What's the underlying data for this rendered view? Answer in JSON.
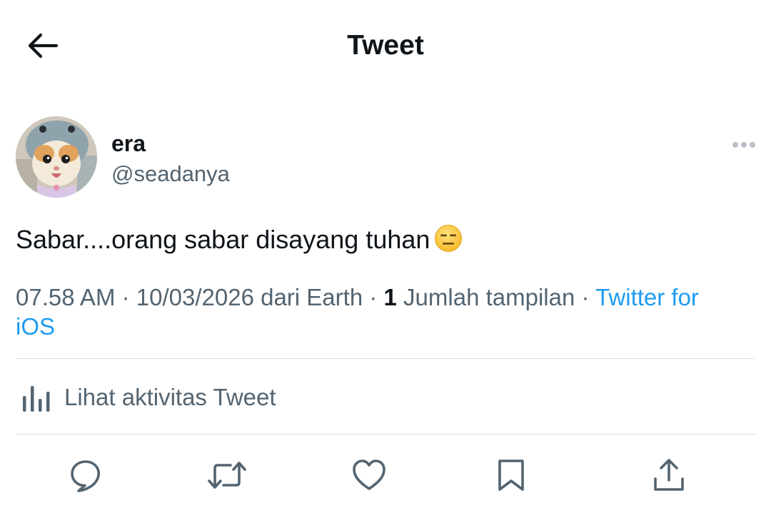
{
  "header": {
    "title": "Tweet",
    "back_icon": "arrow-left-icon"
  },
  "author": {
    "display_name": "era",
    "handle": "@seadanya",
    "avatar_icon": "cat-avatar"
  },
  "tweet": {
    "text": "Sabar....orang sabar disayang tuhan",
    "emoji": "expressionless-face-emoji"
  },
  "meta": {
    "time": "07.58 AM",
    "separator": " · ",
    "date": "10/03/2026",
    "location": " dari Earth",
    "views_count": "1",
    "views_label": " Jumlah tampilan",
    "source": "Twitter for iOS"
  },
  "activity": {
    "label": "Lihat aktivitas Tweet",
    "icon": "bar-chart-icon"
  },
  "actions": [
    "reply-icon",
    "retweet-icon",
    "like-icon",
    "bookmark-icon",
    "share-icon"
  ],
  "colors": {
    "text": "#0f1419",
    "secondary": "#536471",
    "link": "#1d9bf0",
    "divider": "#dcdfe2"
  }
}
